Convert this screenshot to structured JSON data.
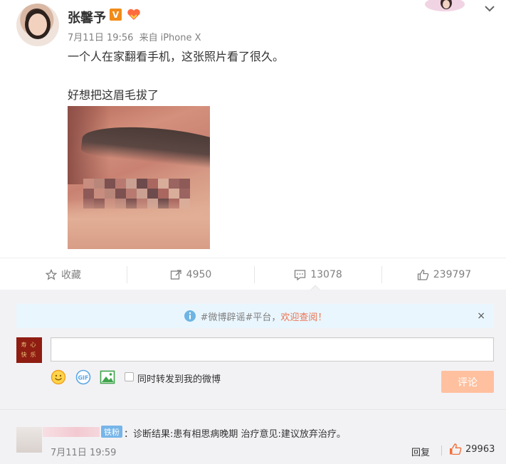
{
  "post": {
    "username": "张馨予",
    "verified_badge": "V",
    "timestamp": "7月11日 19:56",
    "source_prefix": "来自",
    "source": "iPhone X",
    "text_line1": "一个人在家翻看手机，这张照片看了很久。",
    "text_line2": "好想把这眉毛拔了",
    "image_desc_icon": "eyebrow-photo"
  },
  "actions": {
    "favorite_label": "收藏",
    "repost_count": "4950",
    "comment_count": "13078",
    "like_count": "239797"
  },
  "notice": {
    "prefix": "#微博辟谣#平台，",
    "highlight": "欢迎查阅！",
    "close": "×"
  },
  "composer": {
    "avatar_chars": [
      "寿",
      "心",
      "快",
      "乐"
    ],
    "input_value": "",
    "repost_checkbox_label": "同时转发到我的微博",
    "submit_label": "评论"
  },
  "comment": {
    "badge": "铁粉",
    "text": "：诊断结果:患有相思病晚期 治疗意见:建议放弃治疗。",
    "time": "7月11日 19:59",
    "reply_label": "回复",
    "like_count": "29963"
  },
  "colors": {
    "accent_orange": "#eb7350",
    "submit_disabled": "#ffc09f",
    "badge_blue": "#76b5e8",
    "notice_bg": "#eaf6fe"
  }
}
